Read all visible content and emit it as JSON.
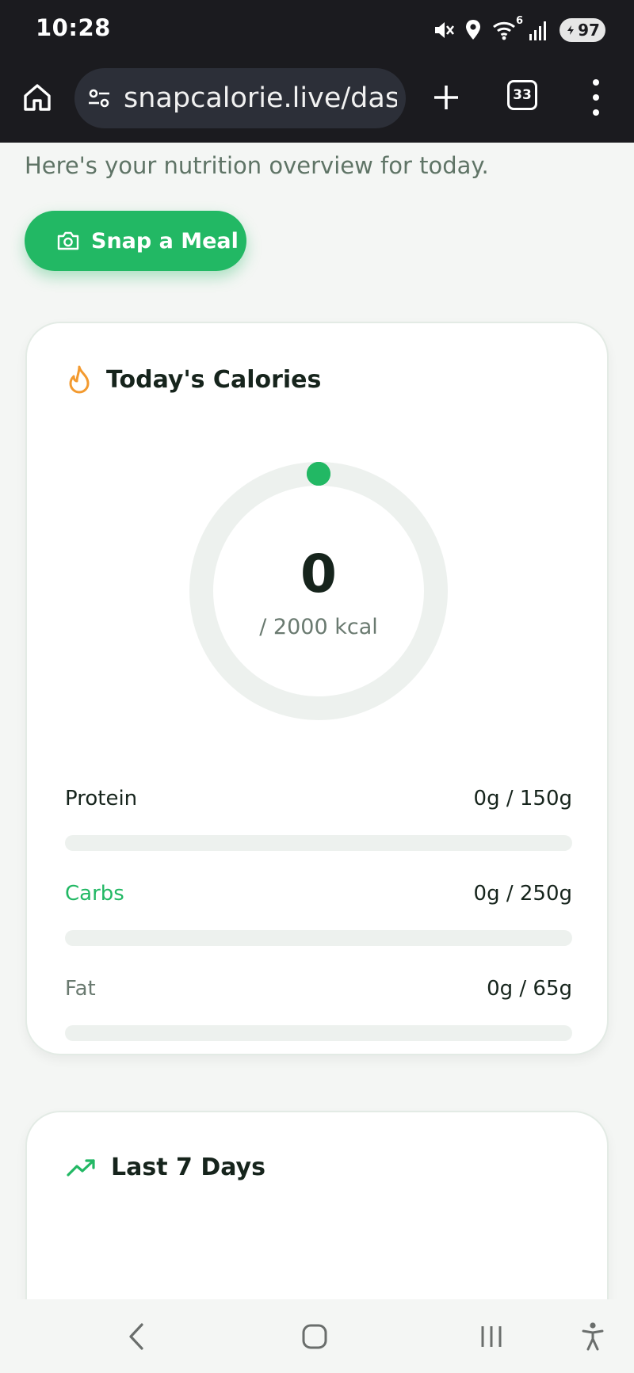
{
  "status_bar": {
    "time": "10:28",
    "wifi_badge": "6",
    "battery": "97",
    "icons": [
      "mute-icon",
      "location-icon",
      "wifi-icon",
      "signal-icon",
      "battery-icon"
    ]
  },
  "browser": {
    "url": "snapcalorie.live/dashboard",
    "tab_count": "33",
    "icons": [
      "home-icon",
      "site-settings-icon",
      "new-tab-icon",
      "tabs-icon",
      "more-menu-icon"
    ]
  },
  "page": {
    "subtitle": "Here's your nutrition overview for today.",
    "snap_button_label": "Snap a Meal",
    "colors": {
      "accent": "#22b864",
      "flame": "#f39a2f",
      "track": "#edf1ee"
    }
  },
  "calories_card": {
    "title": "Today's Calories",
    "consumed": "0",
    "goal_text": "/ 2000 kcal",
    "progress_fraction": 0
  },
  "macros": [
    {
      "name": "Protein",
      "value_text": "0g / 150g",
      "progress_fraction": 0
    },
    {
      "name": "Carbs",
      "value_text": "0g / 250g",
      "progress_fraction": 0
    },
    {
      "name": "Fat",
      "value_text": "0g / 65g",
      "progress_fraction": 0
    }
  ],
  "week_card": {
    "title": "Last 7 Days"
  },
  "nav_bar": {
    "icons": [
      "back-icon",
      "home-circle-icon",
      "recents-icon",
      "accessibility-icon"
    ]
  }
}
